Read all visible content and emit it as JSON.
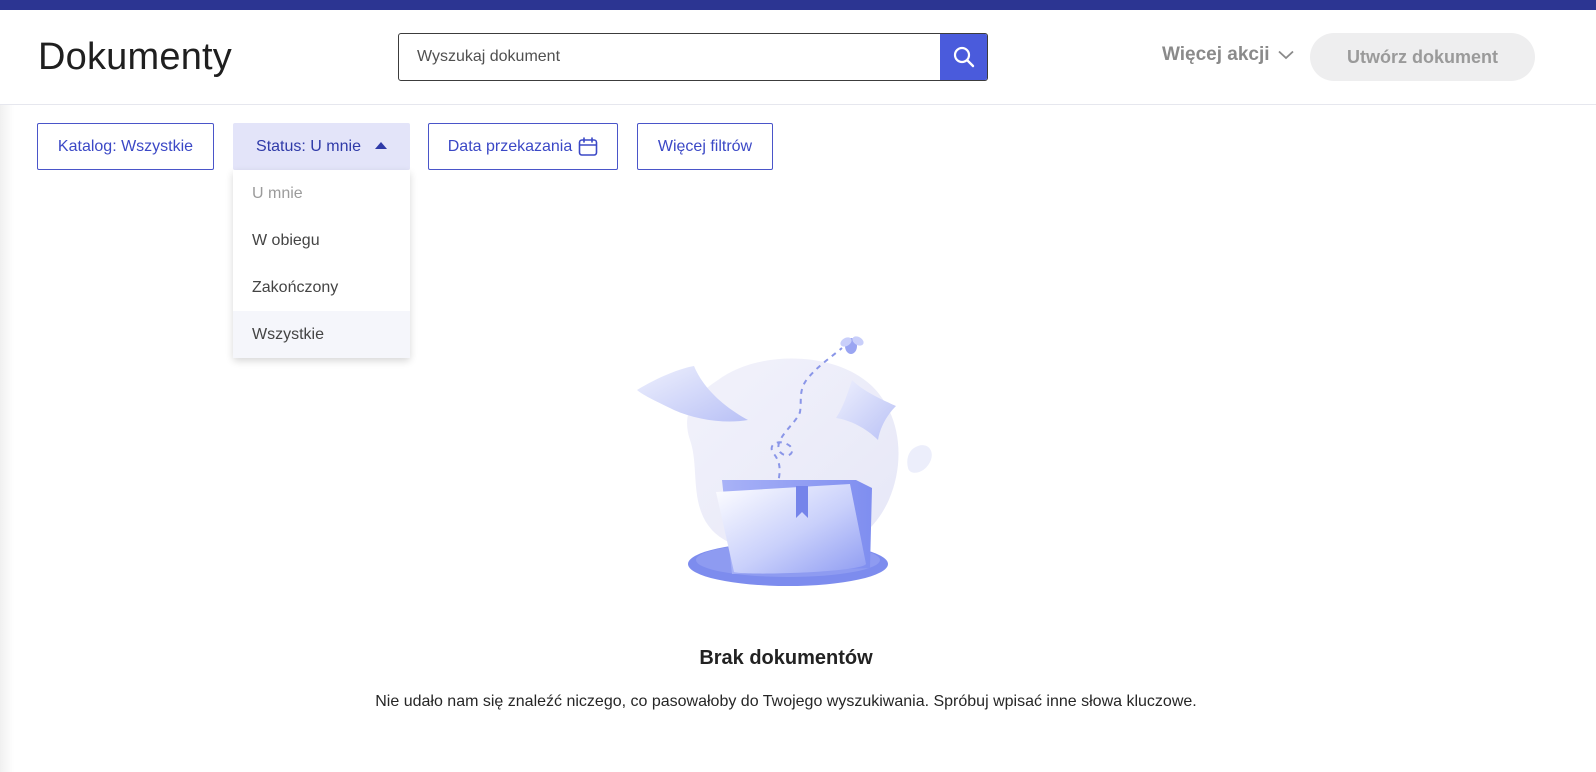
{
  "header": {
    "title": "Dokumenty",
    "search_placeholder": "Wyszukaj dokument",
    "search_icon": "search-icon",
    "more_actions_label": "Więcej akcji",
    "create_label": "Utwórz dokument"
  },
  "filters": {
    "catalog_label": "Katalog: Wszystkie",
    "status_label": "Status: U mnie",
    "date_label": "Data przekazania",
    "more_label": "Więcej filtrów"
  },
  "status_dropdown": {
    "items": [
      {
        "label": "U mnie",
        "selected": true
      },
      {
        "label": "W obiegu"
      },
      {
        "label": "Zakończony"
      },
      {
        "label": "Wszystkie",
        "hovered": true
      }
    ]
  },
  "empty_state": {
    "title": "Brak dokumentów",
    "description": "Nie udało nam się znaleźć niczego, co pasowałoby do Twojego wyszukiwania. Spróbuj wpisać inne słowa kluczowe."
  },
  "colors": {
    "brand_bar": "#2c3592",
    "accent": "#4a5bdc",
    "filter_text": "#3b48c6"
  }
}
